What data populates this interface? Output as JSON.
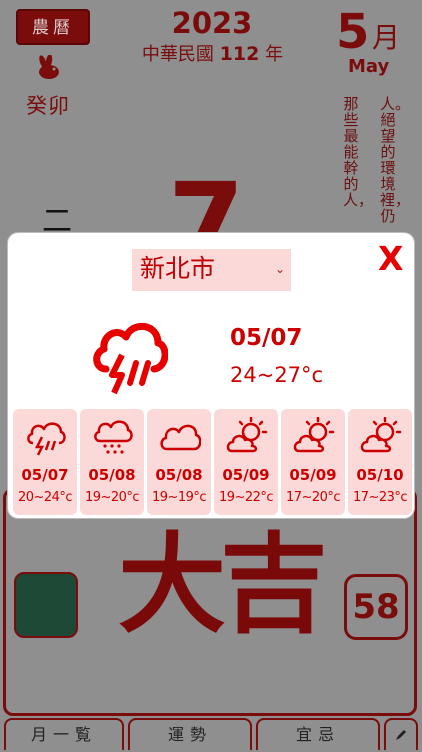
{
  "header": {
    "lunar_button": "農曆",
    "year": "2023",
    "roc_prefix": "中華民國",
    "roc_year": "112",
    "roc_suffix": "年",
    "month_number": "5",
    "month_unit": "月",
    "month_en": "May",
    "ganzhi": "癸卯",
    "weekday": "二",
    "day_partial": "7",
    "quote_col1": "人。絕望的環境裡，仍",
    "quote_col2": "那些最能幹的人，"
  },
  "weather": {
    "city": "新北市",
    "close_label": "X",
    "today": {
      "date": "05/07",
      "temp": "24~27°c",
      "icon": "thunder-rain-icon"
    },
    "forecast": [
      {
        "date": "05/07",
        "temp": "20~24°c",
        "icon": "thunder-rain-icon"
      },
      {
        "date": "05/08",
        "temp": "19~20°c",
        "icon": "rain-icon"
      },
      {
        "date": "05/08",
        "temp": "19~19°c",
        "icon": "cloudy-icon"
      },
      {
        "date": "05/09",
        "temp": "19~22°c",
        "icon": "sun-cloud-icon"
      },
      {
        "date": "05/09",
        "temp": "17~20°c",
        "icon": "sun-cloud-icon"
      },
      {
        "date": "05/10",
        "temp": "17~23°c",
        "icon": "sun-cloud-icon"
      }
    ]
  },
  "fortune": {
    "text": "大吉",
    "day_count": "58"
  },
  "tabs": {
    "calendar": "月一覧",
    "luck": "運勢",
    "dos_donts": "宜忌"
  },
  "colors": {
    "accent": "#cc0000",
    "card_bg": "#fcd9d9",
    "dim_red": "#7a0c0c",
    "overlay": "#8f8f8f"
  }
}
